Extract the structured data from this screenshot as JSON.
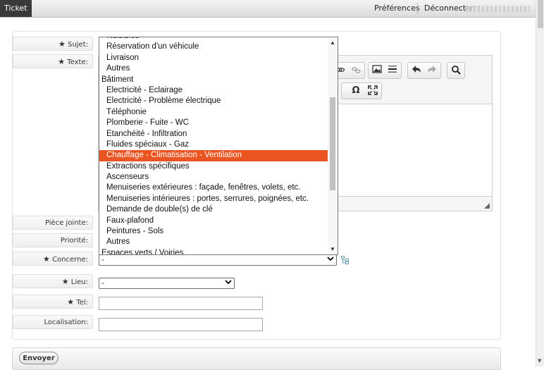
{
  "header": {
    "tab": "Ticket",
    "preferences": "Préférences",
    "logout": "Déconnecter"
  },
  "form": {
    "labels": {
      "subject": "Sujet:",
      "text": "Texte:",
      "attachment": "Pièce jointe:",
      "priority": "Priorité:",
      "concerns": "Concerne:",
      "place": "Lieu:",
      "phone": "Tel:",
      "location": "Localisation:"
    },
    "required_marker": "★",
    "concerns_value": "-",
    "place_value": "-"
  },
  "dropdown": {
    "selected": "Chauffage - Climatisation - Ventilation",
    "items": [
      {
        "text": "Nuisibles",
        "group": false
      },
      {
        "text": "Réservation d'un véhicule",
        "group": false
      },
      {
        "text": "Livraison",
        "group": false
      },
      {
        "text": "Autres",
        "group": false
      },
      {
        "text": "Bâtiment",
        "group": true
      },
      {
        "text": "Electricité - Eclairage",
        "group": false
      },
      {
        "text": "Electricité - Problème électrique",
        "group": false
      },
      {
        "text": "Téléphonie",
        "group": false
      },
      {
        "text": "Plomberie - Fuite - WC",
        "group": false
      },
      {
        "text": "Etanchéité - Infiltration",
        "group": false
      },
      {
        "text": "Fluides spéciaux - Gaz",
        "group": false
      },
      {
        "text": "Chauffage - Climatisation - Ventilation",
        "group": false
      },
      {
        "text": "Extractions spécifiques",
        "group": false
      },
      {
        "text": "Ascenseurs",
        "group": false
      },
      {
        "text": "Menuiseries extérieures : façade, fenêtres, volets, etc.",
        "group": false
      },
      {
        "text": "Menuiseries intérieures : portes, serrures, poignées, etc.",
        "group": false
      },
      {
        "text": "Demande de double(s) de clé",
        "group": false
      },
      {
        "text": "Faux-plafond",
        "group": false
      },
      {
        "text": "Peintures - Sols",
        "group": false
      },
      {
        "text": "Autres",
        "group": false
      },
      {
        "text": "Espaces verts / Voiries",
        "group": true
      }
    ]
  },
  "editor_toolbar": {
    "row1": [
      "link-icon",
      "unlink-icon",
      "image-icon",
      "horizontal-rule-icon",
      "undo-icon",
      "redo-icon",
      "find-icon"
    ],
    "row2": [
      "omega-icon",
      "maximize-icon"
    ],
    "omega_glyph": "Ω"
  },
  "footer": {
    "send_label": "Envoyer"
  },
  "colors": {
    "selection": "#e95420",
    "topbar_tab": "#3a3a3a"
  }
}
